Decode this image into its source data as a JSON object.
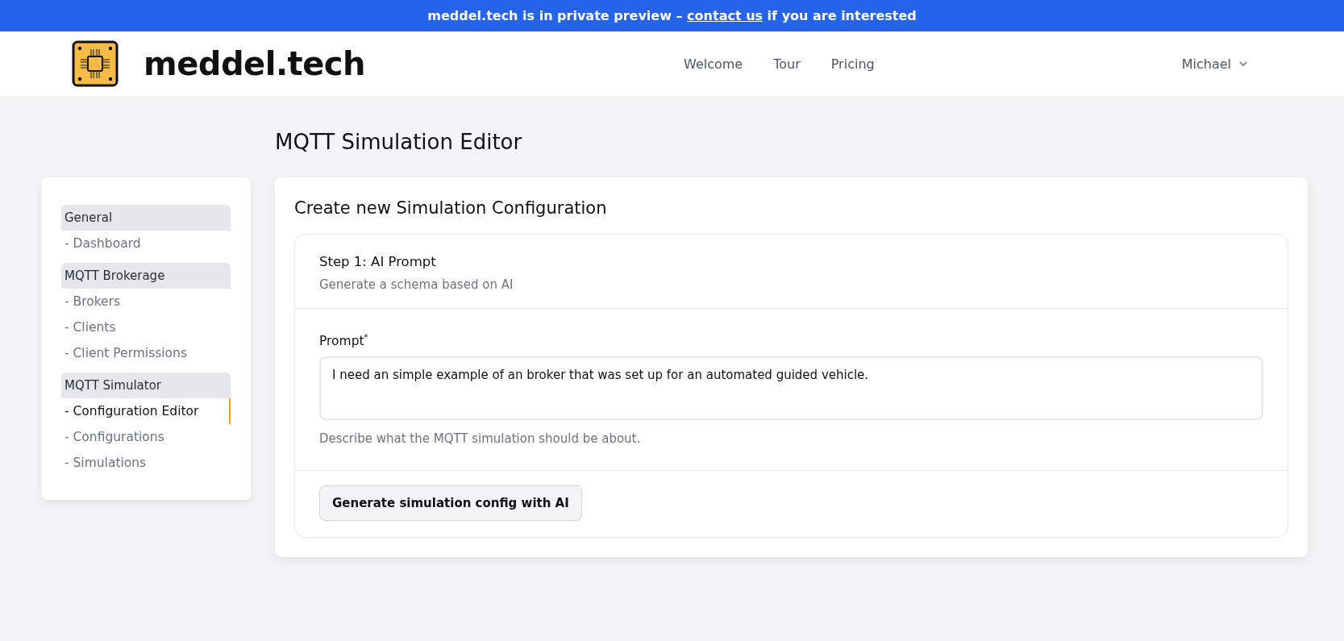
{
  "banner": {
    "before": "meddel.tech is in private preview – ",
    "link": "contact us",
    "after": " if you are interested"
  },
  "header": {
    "brand": "meddel.tech",
    "nav": [
      {
        "label": "Welcome"
      },
      {
        "label": "Tour"
      },
      {
        "label": "Pricing"
      }
    ],
    "user": "Michael"
  },
  "page_title": "MQTT Simulation Editor",
  "sidebar": {
    "groups": [
      {
        "label": "General",
        "items": [
          {
            "label": "- Dashboard",
            "selected": false
          }
        ]
      },
      {
        "label": "MQTT Brokerage",
        "items": [
          {
            "label": "- Brokers",
            "selected": false
          },
          {
            "label": "- Clients",
            "selected": false
          },
          {
            "label": "- Client Permissions",
            "selected": false
          }
        ]
      },
      {
        "label": "MQTT Simulator",
        "items": [
          {
            "label": "- Configuration Editor",
            "selected": true
          },
          {
            "label": "- Configurations",
            "selected": false
          },
          {
            "label": "- Simulations",
            "selected": false
          }
        ]
      }
    ]
  },
  "card": {
    "title": "Create new Simulation Configuration",
    "step": {
      "title": "Step 1: AI Prompt",
      "subtitle": "Generate a schema based on AI",
      "field_label": "Prompt",
      "required_mark": "*",
      "value": "I need an simple example of an broker that was set up for an automated guided vehicle.",
      "help": "Describe what the MQTT simulation should be about.",
      "button": "Generate simulation config with AI"
    }
  }
}
